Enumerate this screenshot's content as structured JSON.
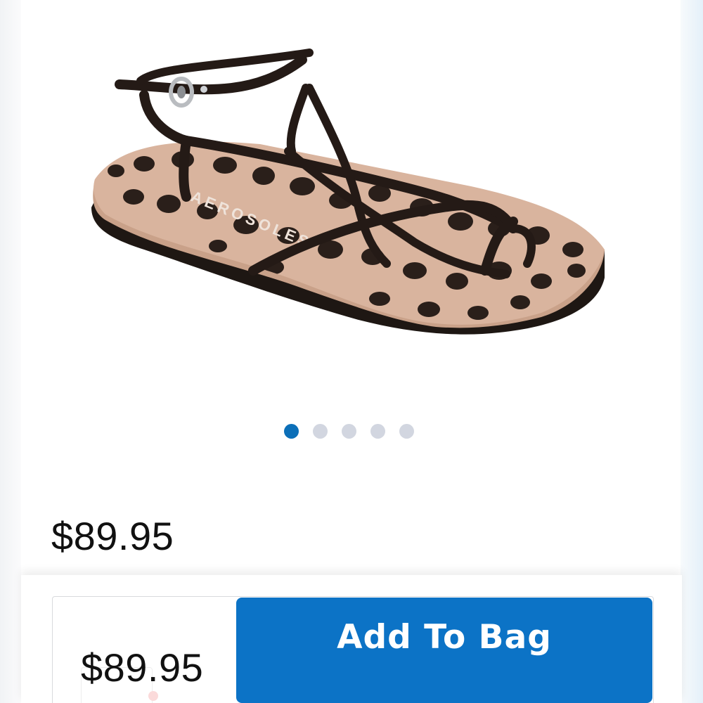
{
  "product": {
    "image_icon": "leopard-print-strappy-sandal",
    "brand_imprint": "AEROSOLES",
    "price": "$89.95"
  },
  "gallery": {
    "total_images": 5,
    "active_index": 0
  },
  "purchase_bar": {
    "price": "$89.95",
    "add_to_bag_label": "Add To Bag"
  },
  "colors": {
    "accent": "#0c73c6",
    "active_dot": "#0c6fb8",
    "inactive_dot": "#d2d6e0"
  }
}
